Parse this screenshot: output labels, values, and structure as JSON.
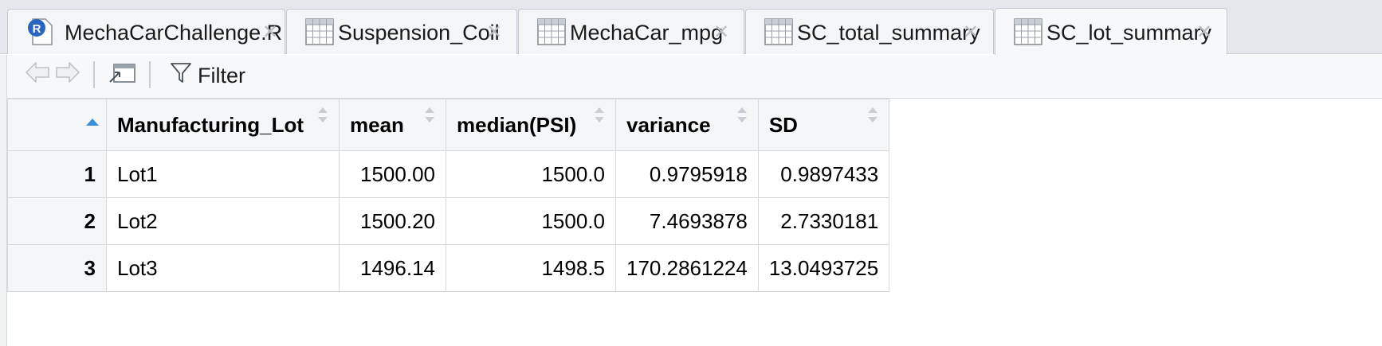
{
  "tabs": [
    {
      "label": "MechaCarChallenge.R",
      "icon": "r-script-icon",
      "active": false
    },
    {
      "label": "Suspension_Coil",
      "icon": "table-icon",
      "active": false
    },
    {
      "label": "MechaCar_mpg",
      "icon": "table-icon",
      "active": false
    },
    {
      "label": "SC_total_summary",
      "icon": "table-icon",
      "active": false
    },
    {
      "label": "SC_lot_summary",
      "icon": "table-icon",
      "active": true
    }
  ],
  "tab_close_glyph": "✕",
  "r_icon_letter": "R",
  "toolbar": {
    "back_icon": "arrow-left-icon",
    "forward_icon": "arrow-right-icon",
    "popout_icon": "popout-window-icon",
    "filter_label": "Filter"
  },
  "grid": {
    "columns": [
      "Manufacturing_Lot",
      "mean",
      "median(PSI)",
      "variance",
      "SD"
    ],
    "sorted_column": "row-index",
    "rows": [
      {
        "index": "1",
        "cells": [
          "Lot1",
          "1500.00",
          "1500.0",
          "0.9795918",
          "0.9897433"
        ]
      },
      {
        "index": "2",
        "cells": [
          "Lot2",
          "1500.20",
          "1500.0",
          "7.4693878",
          "2.7330181"
        ]
      },
      {
        "index": "3",
        "cells": [
          "Lot3",
          "1496.14",
          "1498.5",
          "170.2861224",
          "13.0493725"
        ]
      }
    ]
  },
  "colors": {
    "tab_bar_bg": "#e4e8ec",
    "sort_active": "#3a8fd6",
    "sort_inactive": "#c9ced4",
    "r_icon": "#2b65c2"
  }
}
